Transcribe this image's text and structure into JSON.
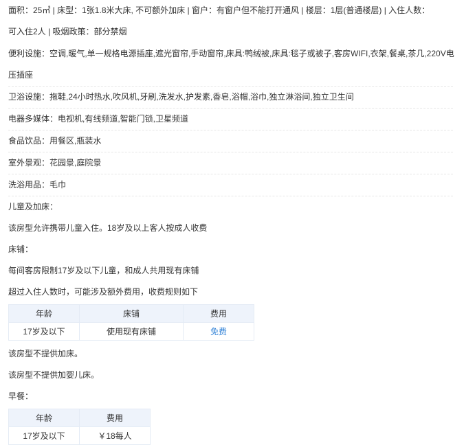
{
  "room_info": {
    "line1": "面积：25㎡ | 床型：1张1.8米大床, 不可额外加床 | 窗户：有窗户但不能打开通风 | 楼层：1层(普通楼层) | 入住人数：",
    "line2": "可入住2人 | 吸烟政策：部分禁烟"
  },
  "facilities": {
    "convenience_l1": "便利设施：空调,暖气,单一规格电源插座,遮光窗帘,手动窗帘,床具:鸭绒被,床具:毯子或被子,客房WIFI,衣架,餐桌,茶几,220V电",
    "convenience_l2": "压插座",
    "bathroom": "卫浴设施：拖鞋,24小时热水,吹风机,牙刷,洗发水,护发素,香皂,浴帽,浴巾,独立淋浴间,独立卫生间",
    "media": "电器多媒体：电视机,有线频道,智能门锁,卫星频道",
    "food": "食品饮品：用餐区,瓶装水",
    "view": "室外景观：花园景,庭院景",
    "toiletries": "洗浴用品：毛巾"
  },
  "children": {
    "title": "儿童及加床：",
    "policy": "该房型允许携带儿童入住。18岁及以上客人按成人收费",
    "bedding_title": "床铺：",
    "bedding_rule": "每间客房限制17岁及以下儿童，和成人共用现有床铺",
    "extra_rule": "超过入住人数时，可能涉及额外费用，收费规则如下",
    "bed_table": {
      "headers": [
        "年龄",
        "床铺",
        "费用"
      ],
      "row": {
        "age": "17岁及以下",
        "bed": "使用现有床铺",
        "fee": "免费"
      }
    },
    "no_extra_bed": "该房型不提供加床。",
    "no_crib": "该房型不提供加婴儿床。"
  },
  "breakfast": {
    "title": "早餐：",
    "table": {
      "headers": [
        "年龄",
        "费用"
      ],
      "row": {
        "age": "17岁及以下",
        "fee": "￥18每人"
      }
    }
  },
  "colors": {
    "accent_link": "#2c7fd6",
    "table_header_bg": "#eef3fb"
  }
}
